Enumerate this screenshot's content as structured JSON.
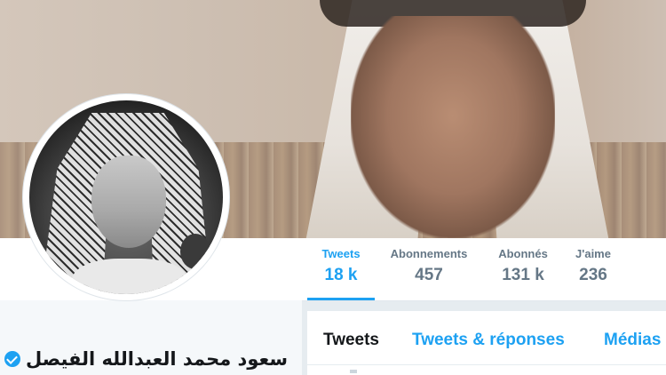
{
  "profile": {
    "display_name": "سعود محمد العبدالله الفيصل",
    "verified": true
  },
  "stats": [
    {
      "label": "Tweets",
      "value": "18 k",
      "active": true
    },
    {
      "label": "Abonnements",
      "value": "457",
      "active": false
    },
    {
      "label": "Abonnés",
      "value": "131 k",
      "active": false
    },
    {
      "label": "J'aime",
      "value": "236",
      "active": false
    }
  ],
  "timeline_tabs": [
    {
      "label": "Tweets",
      "active": true
    },
    {
      "label": "Tweets & réponses",
      "active": false
    },
    {
      "label": "Médias",
      "active": false
    }
  ],
  "colors": {
    "accent": "#1da1f2",
    "text_primary": "#14171a",
    "text_secondary": "#657786",
    "background": "#e6ecf0"
  }
}
